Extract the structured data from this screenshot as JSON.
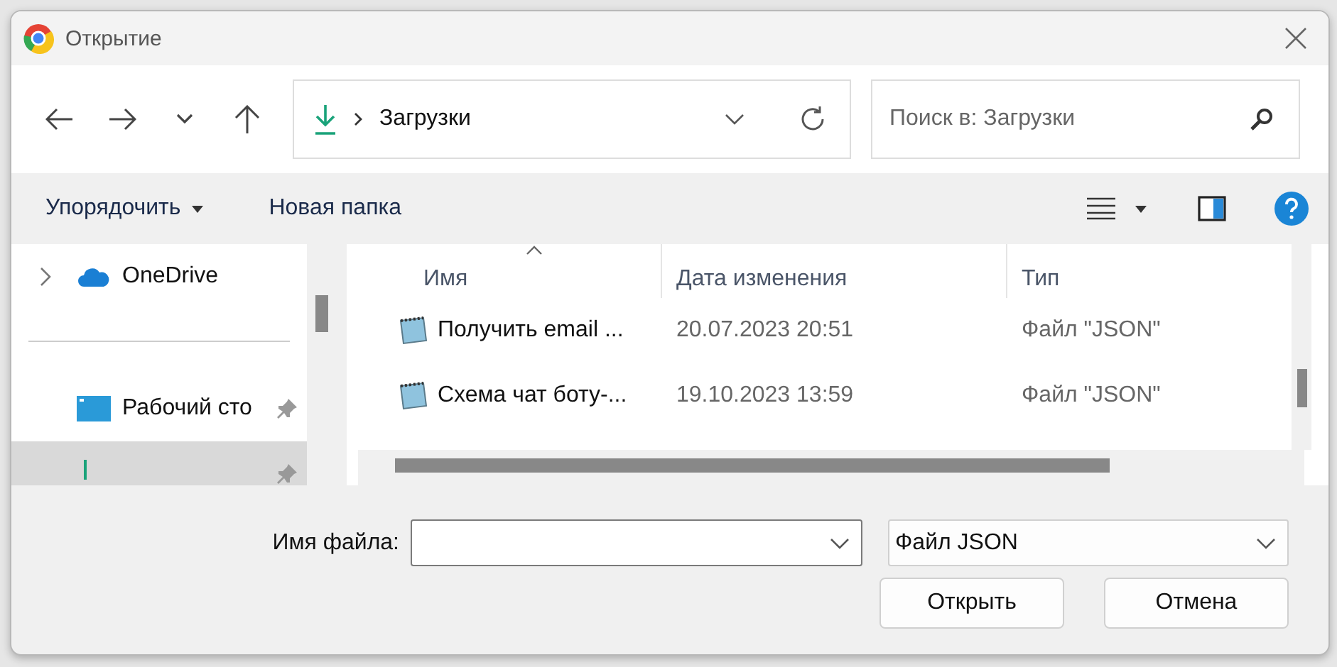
{
  "window": {
    "title": "Открытие"
  },
  "address": {
    "path": "Загрузки"
  },
  "search": {
    "placeholder": "Поиск в: Загрузки"
  },
  "toolbar": {
    "organize": "Упорядочить",
    "new_folder": "Новая папка"
  },
  "sidebar": {
    "top": [
      {
        "kind": "cloud",
        "label": "OneDrive",
        "expandable": true,
        "pinned": false,
        "selected": false
      }
    ],
    "quick_access": [
      {
        "kind": "desktop",
        "label": "Рабочий сто",
        "expandable": false,
        "pinned": true,
        "selected": false
      },
      {
        "kind": "downloads",
        "expandable": false,
        "pinned": true,
        "selected": true
      }
    ]
  },
  "table": {
    "columns": [
      {
        "label": "Имя",
        "sorted": true
      },
      {
        "label": "Дата изменения",
        "sorted": false
      },
      {
        "label": "Тип",
        "sorted": false
      }
    ],
    "rows": [
      {
        "name": "Получить email ...",
        "modified": "20.07.2023 20:51",
        "type": "Файл \"JSON\""
      },
      {
        "name": "Схема чат боту-...",
        "modified": "19.10.2023 13:59",
        "type": "Файл \"JSON\""
      }
    ]
  },
  "footer": {
    "filename_label": "Имя файла:",
    "filter": "Файл JSON",
    "buttons": [
      "Открыть",
      "Отмена"
    ]
  }
}
